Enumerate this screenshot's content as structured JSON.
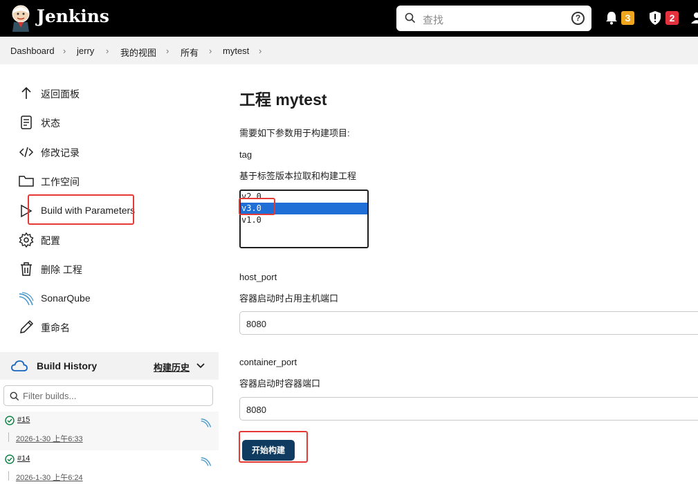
{
  "header": {
    "brand": "Jenkins",
    "search_placeholder": "查找",
    "help_symbol": "?",
    "notifications_count": "3",
    "security_count": "2",
    "notifications_color": "#f0a51e",
    "security_color": "#e3323e"
  },
  "breadcrumbs": [
    "Dashboard",
    "jerry",
    "我的视图",
    "所有",
    "mytest"
  ],
  "sidebar": {
    "items": [
      {
        "label": "返回面板",
        "icon": "arrow-up-icon"
      },
      {
        "label": "状态",
        "icon": "document-icon"
      },
      {
        "label": "修改记录",
        "icon": "code-icon"
      },
      {
        "label": "工作空间",
        "icon": "folder-icon"
      },
      {
        "label": "Build with Parameters",
        "icon": "play-icon"
      },
      {
        "label": "配置",
        "icon": "gear-icon"
      },
      {
        "label": "删除 工程",
        "icon": "trash-icon"
      },
      {
        "label": "SonarQube",
        "icon": "sonarqube-icon"
      },
      {
        "label": "重命名",
        "icon": "pencil-icon"
      }
    ]
  },
  "build_history": {
    "title": "Build History",
    "trend_link": "构建历史",
    "filter_placeholder": "Filter builds...",
    "builds": [
      {
        "number": "#15",
        "time": "2026-1-30 上午6:33",
        "status": "success"
      },
      {
        "number": "#14",
        "time": "2026-1-30 上午6:24",
        "status": "success"
      }
    ]
  },
  "main": {
    "title": "工程 mytest",
    "intro": "需要如下参数用于构建项目:",
    "params": [
      {
        "name": "tag",
        "description": "基于标签版本拉取和构建工程",
        "options": [
          "v2.0",
          "v3.0",
          "v1.0"
        ],
        "selected": "v3.0"
      },
      {
        "name": "host_port",
        "description": "容器启动时占用主机端口",
        "value": "8080"
      },
      {
        "name": "container_port",
        "description": "容器启动时容器端口",
        "value": "8080"
      }
    ],
    "submit_label": "开始构建"
  }
}
